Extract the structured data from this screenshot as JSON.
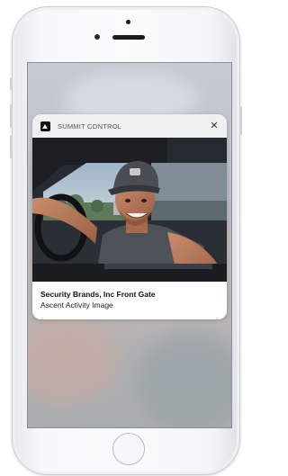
{
  "notification": {
    "app_name": "SUMMIT CONTROL",
    "app_icon": "summit-control-app-icon",
    "close_icon": "close-icon",
    "title": "Security Brands, Inc Front Gate",
    "subtitle": "Ascent Activity Image",
    "image_subject": "man-in-truck-photo"
  },
  "device": {
    "home_button_icon": "home-button"
  }
}
